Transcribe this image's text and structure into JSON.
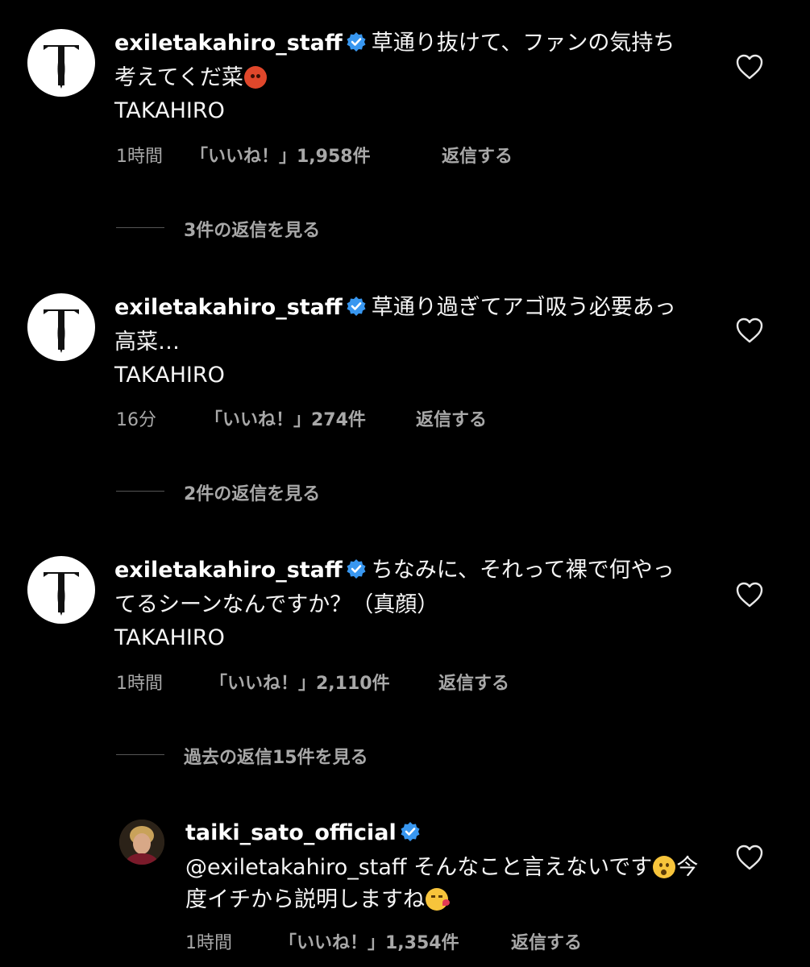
{
  "comments": [
    {
      "username": "exiletakahiro_staff",
      "text_part1": "草通り抜けて、ファンの気持ち考えてくだ菜",
      "emoji": "angry-face",
      "signature": "TAKAHIRO",
      "time": "1時間",
      "likes": "「いいね！」1,958件",
      "reply_label": "返信する",
      "view_replies": "3件の返信を見る"
    },
    {
      "username": "exiletakahiro_staff",
      "text_part1": "草通り過ぎてアゴ吸う必要あっ高菜…",
      "signature": "TAKAHIRO",
      "time": "16分",
      "likes": "「いいね！」274件",
      "reply_label": "返信する",
      "view_replies": "2件の返信を見る"
    },
    {
      "username": "exiletakahiro_staff",
      "text_part1": "ちなみに、それって裸で何やってるシーンなんですか？（真顔）",
      "signature": "TAKAHIRO",
      "time": "1時間",
      "likes": "「いいね！」2,110件",
      "reply_label": "返信する",
      "view_replies": "過去の返信15件を見る"
    }
  ],
  "reply": {
    "username": "taiki_sato_official",
    "mention": "@exiletakahiro_staff",
    "text_part1": "そんなこと言えないです",
    "emoji1": "hushed-face",
    "text_part2": "今度イチから説明しますね",
    "emoji2": "kissing-face-with-heart",
    "time": "1時間",
    "likes": "「いいね！」1,354件",
    "reply_label": "返信する"
  },
  "icons": {
    "verified": "verified-badge-icon",
    "heart": "heart-outline-icon",
    "verified_color": "#3897f0"
  }
}
